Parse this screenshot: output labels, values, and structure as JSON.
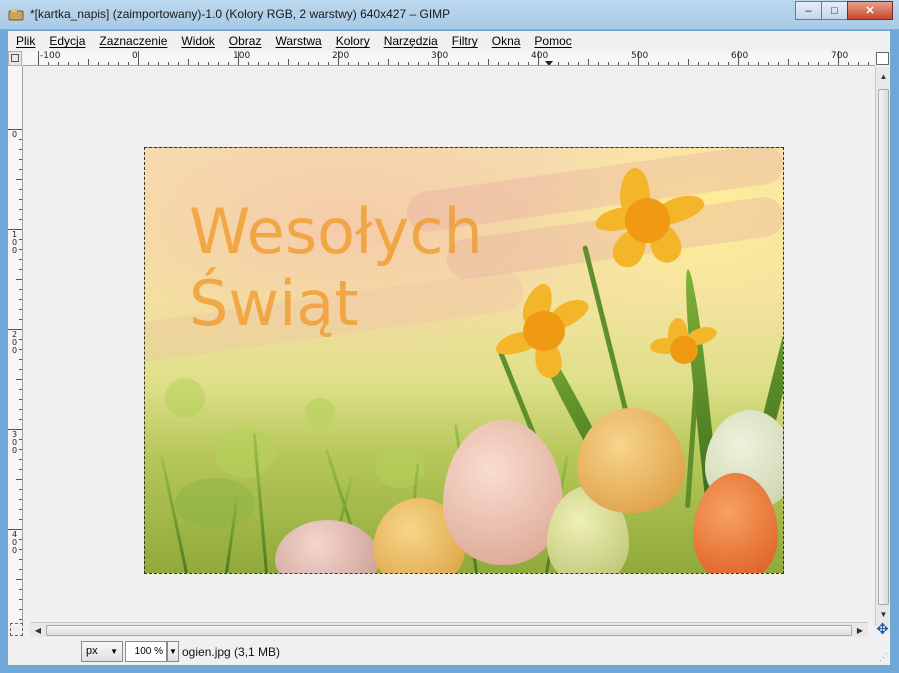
{
  "window": {
    "title": "*[kartka_napis] (zaimportowany)-1.0 (Kolory RGB, 2 warstwy) 640x427 – GIMP",
    "minimize": "–",
    "maximize": "□",
    "close": "✕"
  },
  "menu": [
    "Plik",
    "Edycja",
    "Zaznaczenie",
    "Widok",
    "Obraz",
    "Warstwa",
    "Kolory",
    "Narzędzia",
    "Filtry",
    "Okna",
    "Pomoc"
  ],
  "rulers": {
    "horizontal": [
      "-100",
      "0",
      "100",
      "200",
      "300",
      "400",
      "500",
      "600",
      "700"
    ],
    "vertical": [
      "0",
      "1 0 0",
      "2 0 0",
      "3 0 0",
      "4 0 0"
    ]
  },
  "canvas": {
    "text_layer": "Wesołych\nŚwiąt",
    "text_color": "#f0961e"
  },
  "statusbar": {
    "unit": "px",
    "zoom": "100 %",
    "status": "ogien.jpg (3,1 MB)"
  },
  "icons": {
    "app": "gimp-icon",
    "navigate": "navigate-icon",
    "quick_mask": "quick-mask-icon",
    "ruler_menu": "ruler-menu-icon"
  },
  "colors": {
    "titlebar": "#bcd8ef",
    "workspace": "#f0f0f0",
    "close_button": "#c9462d"
  }
}
